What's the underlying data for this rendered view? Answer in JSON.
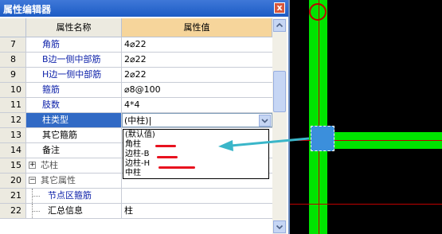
{
  "window": {
    "title": "属性编辑器",
    "close_label": "x"
  },
  "grid": {
    "header_name": "属性名称",
    "header_value": "属性值",
    "rows": [
      {
        "num": "7",
        "name": "角筋",
        "value": "4⌀22"
      },
      {
        "num": "8",
        "name": "B边一侧中部筋",
        "value": "2⌀22"
      },
      {
        "num": "9",
        "name": "H边一侧中部筋",
        "value": "2⌀22"
      },
      {
        "num": "10",
        "name": "箍筋",
        "value": "⌀8@100"
      },
      {
        "num": "11",
        "name": "肢数",
        "value": "4*4"
      },
      {
        "num": "12",
        "name": "柱类型",
        "value": "(中柱)"
      },
      {
        "num": "13",
        "name": "其它箍筋",
        "value": ""
      },
      {
        "num": "14",
        "name": "备注",
        "value": ""
      },
      {
        "num": "15",
        "name": "芯柱",
        "value": "",
        "expander": "+"
      },
      {
        "num": "20",
        "name": "其它属性",
        "value": "",
        "expander": "−"
      },
      {
        "num": "21",
        "name": "节点区箍筋",
        "value": ""
      },
      {
        "num": "22",
        "name": "汇总信息",
        "value": "柱"
      }
    ]
  },
  "dropdown": {
    "options": [
      "(默认值)",
      "角柱",
      "边柱-B",
      "边柱-H",
      "中柱"
    ]
  },
  "colors": {
    "title_bar": "#2a66cf",
    "selected_row": "#316ac5",
    "cad_column": "#00e400",
    "annotation_arrow": "#3ab6c9",
    "annotation_strike": "#e8121f"
  }
}
